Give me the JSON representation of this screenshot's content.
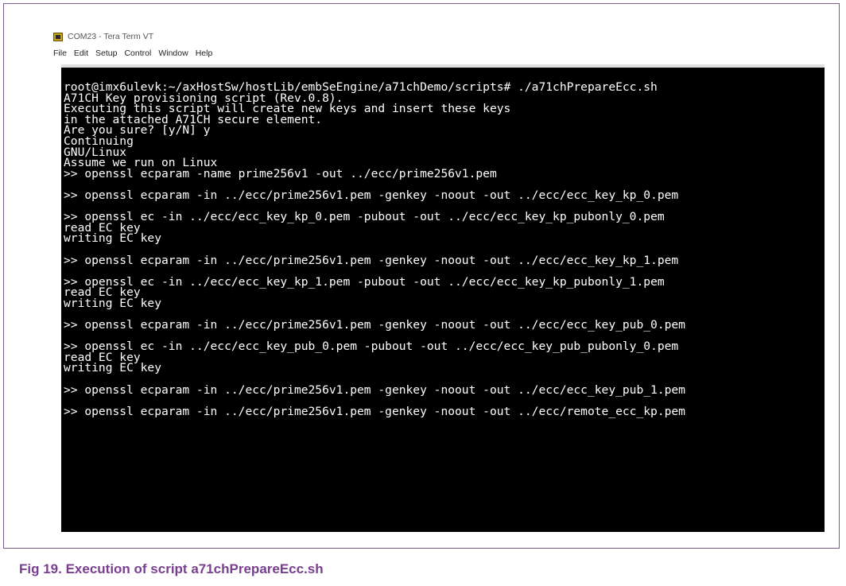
{
  "window": {
    "title": "COM23 - Tera Term VT",
    "icon": "tera-term-icon"
  },
  "menu": {
    "items": [
      "File",
      "Edit",
      "Setup",
      "Control",
      "Window",
      "Help"
    ]
  },
  "terminal": {
    "background": "#000000",
    "foreground": "#ffffff",
    "lines": [
      "root@imx6ulevk:~/axHostSw/hostLib/embSeEngine/a71chDemo/scripts# ./a71chPrepareEcc.sh",
      "A71CH Key provisioning script (Rev.0.8).",
      "Executing this script will create new keys and insert these keys",
      "in the attached A71CH secure element.",
      "Are you sure? [y/N] y",
      "Continuing",
      "GNU/Linux",
      "Assume we run on Linux",
      ">> openssl ecparam -name prime256v1 -out ../ecc/prime256v1.pem",
      "",
      ">> openssl ecparam -in ../ecc/prime256v1.pem -genkey -noout -out ../ecc/ecc_key_kp_0.pem",
      "",
      ">> openssl ec -in ../ecc/ecc_key_kp_0.pem -pubout -out ../ecc/ecc_key_kp_pubonly_0.pem",
      "read EC key",
      "writing EC key",
      "",
      ">> openssl ecparam -in ../ecc/prime256v1.pem -genkey -noout -out ../ecc/ecc_key_kp_1.pem",
      "",
      ">> openssl ec -in ../ecc/ecc_key_kp_1.pem -pubout -out ../ecc/ecc_key_kp_pubonly_1.pem",
      "read EC key",
      "writing EC key",
      "",
      ">> openssl ecparam -in ../ecc/prime256v1.pem -genkey -noout -out ../ecc/ecc_key_pub_0.pem",
      "",
      ">> openssl ec -in ../ecc/ecc_key_pub_0.pem -pubout -out ../ecc/ecc_key_pub_pubonly_0.pem",
      "read EC key",
      "writing EC key",
      "",
      ">> openssl ecparam -in ../ecc/prime256v1.pem -genkey -noout -out ../ecc/ecc_key_pub_1.pem",
      "",
      ">> openssl ecparam -in ../ecc/prime256v1.pem -genkey -noout -out ../ecc/remote_ecc_kp.pem"
    ]
  },
  "caption": {
    "text": "Fig 19.  Execution of script a71chPrepareEcc.sh",
    "color": "#7a3e91"
  },
  "colors": {
    "frame_border": "#7a5a8c"
  }
}
